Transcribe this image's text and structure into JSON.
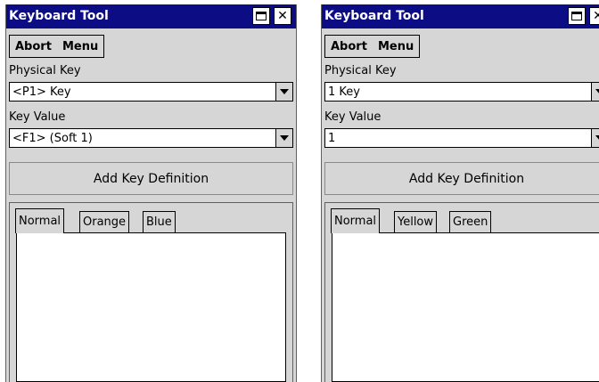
{
  "left": {
    "title": "Keyboard Tool",
    "menu": [
      "Abort",
      "Menu"
    ],
    "physical_key_label": "Physical Key",
    "physical_key_value": "<P1> Key",
    "key_value_label": "Key Value",
    "key_value_value": "<F1> (Soft 1)",
    "add_button": "Add Key Definition",
    "tabs": [
      "Normal",
      "Orange",
      "Blue"
    ]
  },
  "right": {
    "title": "Keyboard Tool",
    "menu": [
      "Abort",
      "Menu"
    ],
    "physical_key_label": "Physical Key",
    "physical_key_value": "1 Key",
    "key_value_label": "Key Value",
    "key_value_value": "1",
    "add_button": "Add Key Definition",
    "tabs": [
      "Normal",
      "Yellow",
      "Green"
    ]
  },
  "icons": {
    "maximize": "maximize-icon",
    "close": "close-icon",
    "dropdown": "chevron-down-icon"
  },
  "colors": {
    "titlebar": "#0c0c84",
    "window_bg": "#d6d6d6"
  }
}
